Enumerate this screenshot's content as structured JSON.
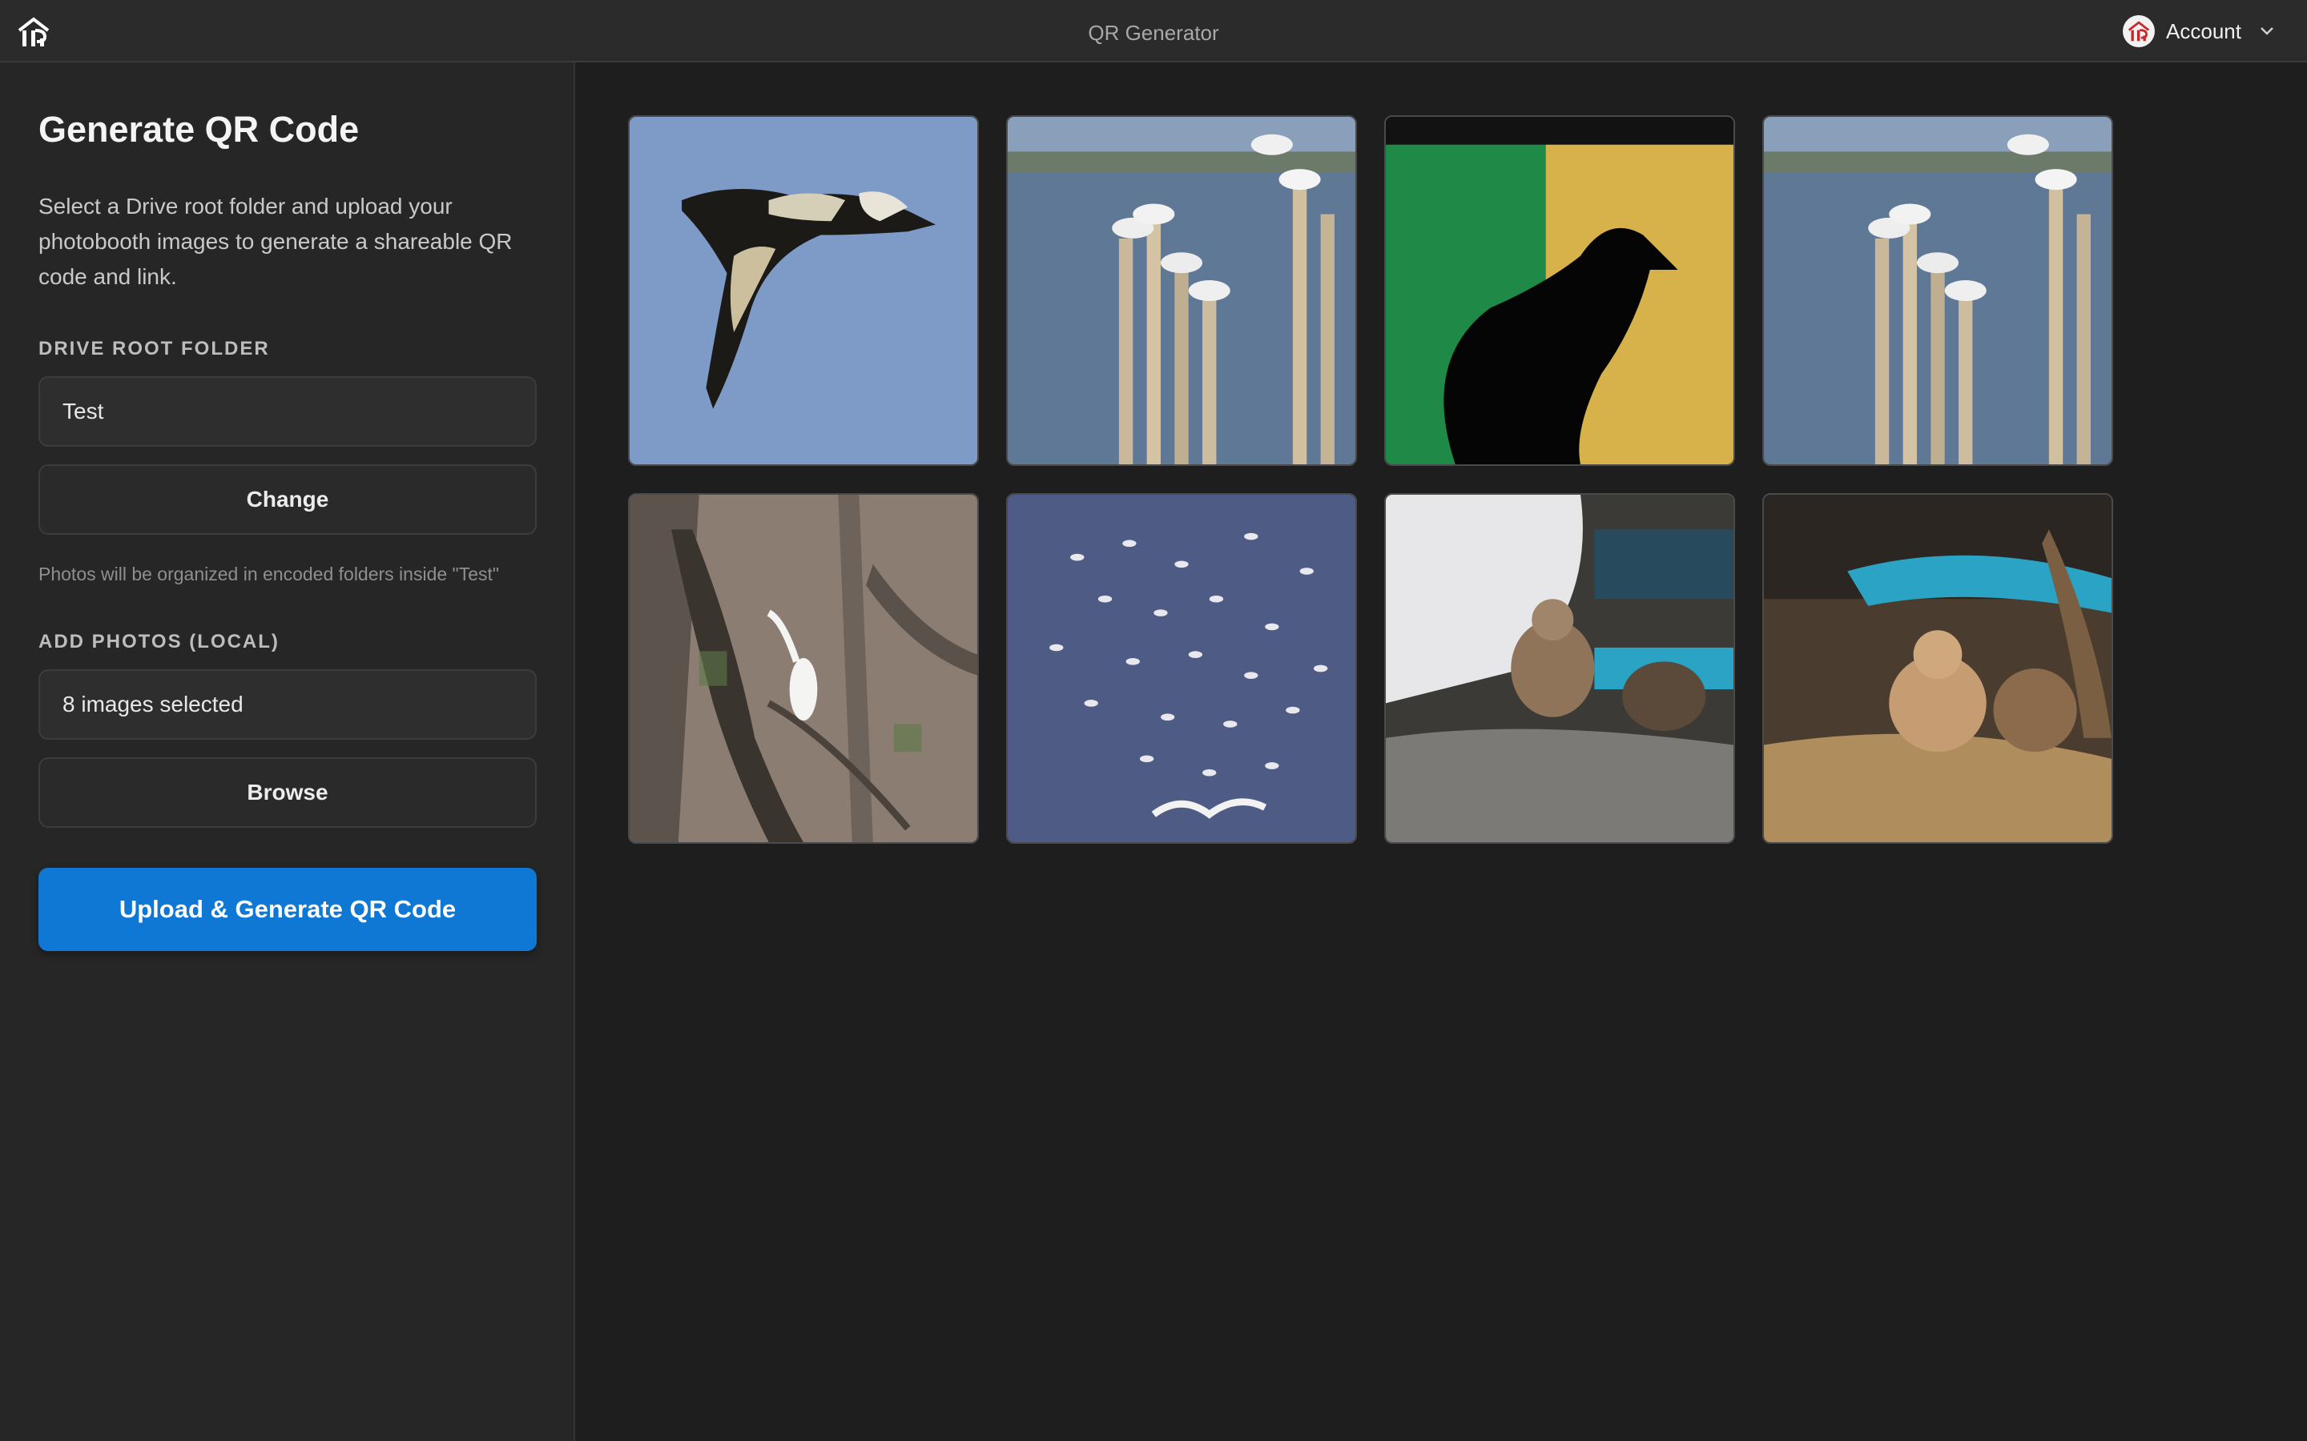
{
  "titlebar": {
    "app_title": "QR Generator",
    "logo_icon": "house-logo-icon",
    "account_label": "Account"
  },
  "sidebar": {
    "title": "Generate QR Code",
    "description": "Select a Drive root folder and upload your photobooth images to generate a shareable QR code and link.",
    "drive_label": "DRIVE ROOT FOLDER",
    "drive_value": "Test",
    "change_label": "Change",
    "hint": "Photos will be organized in encoded folders inside \"Test\"",
    "photos_label": "ADD PHOTOS (LOCAL)",
    "photos_value": "8 images selected",
    "browse_label": "Browse",
    "primary_label": "Upload & Generate QR Code"
  },
  "colors": {
    "accent": "#0f78d4",
    "background": "#1e1e1e",
    "sidebar": "#262626"
  },
  "gallery": {
    "items": [
      {
        "subject": "bird in flight against blue sky"
      },
      {
        "subject": "gulls perched on wooden posts over water"
      },
      {
        "subject": "dark bird silhouette against green and yellow backdrop"
      },
      {
        "subject": "gulls perched on wooden posts over water"
      },
      {
        "subject": "white egret among branches"
      },
      {
        "subject": "flock of gulls over water"
      },
      {
        "subject": "chick standing on rock"
      },
      {
        "subject": "chicks in nest"
      }
    ]
  }
}
